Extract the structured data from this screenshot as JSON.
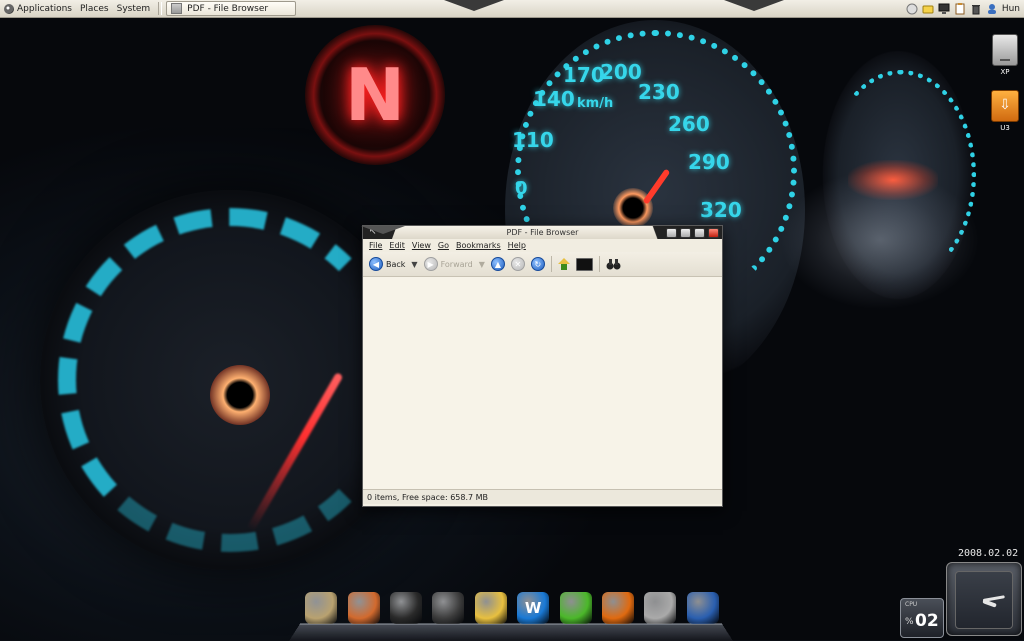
{
  "top_panel": {
    "menus": [
      "Applications",
      "Places",
      "System"
    ],
    "task_button": "PDF - File Browser",
    "tray": {
      "icons": [
        "network-icon",
        "keyring-icon",
        "monitor-icon",
        "clipboard-icon",
        "trash-icon",
        "user-icon"
      ],
      "user": "Hun"
    }
  },
  "desktop_icons": [
    {
      "label": "XP",
      "icon": "hard-drive-icon"
    },
    {
      "label": "U3",
      "icon": "usb-drive-icon"
    }
  ],
  "window": {
    "title": "PDF - File Browser",
    "menus": [
      "File",
      "Edit",
      "View",
      "Go",
      "Bookmarks",
      "Help"
    ],
    "toolbar": {
      "back_label": "Back",
      "forward_label": "Forward"
    },
    "status": "0 items, Free space: 658.7 MB"
  },
  "wallpaper": {
    "gear_letter": "N",
    "speed_ticks": [
      "110",
      "140",
      "170",
      "200",
      "230",
      "260",
      "290",
      "320"
    ],
    "speed_unit": "km/h",
    "speed_zero": "0"
  },
  "dock": {
    "items": [
      {
        "name": "dock-gimp-icon",
        "glyph": "",
        "color": "#b9a270"
      },
      {
        "name": "dock-paint-icon",
        "glyph": "",
        "color": "#d26a2e"
      },
      {
        "name": "dock-notebook-icon",
        "glyph": "",
        "color": "#2a2a2a"
      },
      {
        "name": "dock-robot-icon",
        "glyph": "",
        "color": "#3c3c3c"
      },
      {
        "name": "dock-palette-icon",
        "glyph": "",
        "color": "#e8c040"
      },
      {
        "name": "dock-word-icon",
        "glyph": "W",
        "color": "#1a7ad6"
      },
      {
        "name": "dock-spreadsheet-icon",
        "glyph": "",
        "color": "#4bb82a"
      },
      {
        "name": "dock-firefox-icon",
        "glyph": "",
        "color": "#e06a10"
      },
      {
        "name": "dock-drive-icon",
        "glyph": "",
        "color": "#aaaaaa"
      },
      {
        "name": "dock-thunderbird-icon",
        "glyph": "",
        "color": "#2a5fb0"
      }
    ]
  },
  "widgets": {
    "date": "2008.02.02",
    "cpu_label": "CPU",
    "cpu_percent_sign": "%",
    "cpu_value": "02"
  }
}
